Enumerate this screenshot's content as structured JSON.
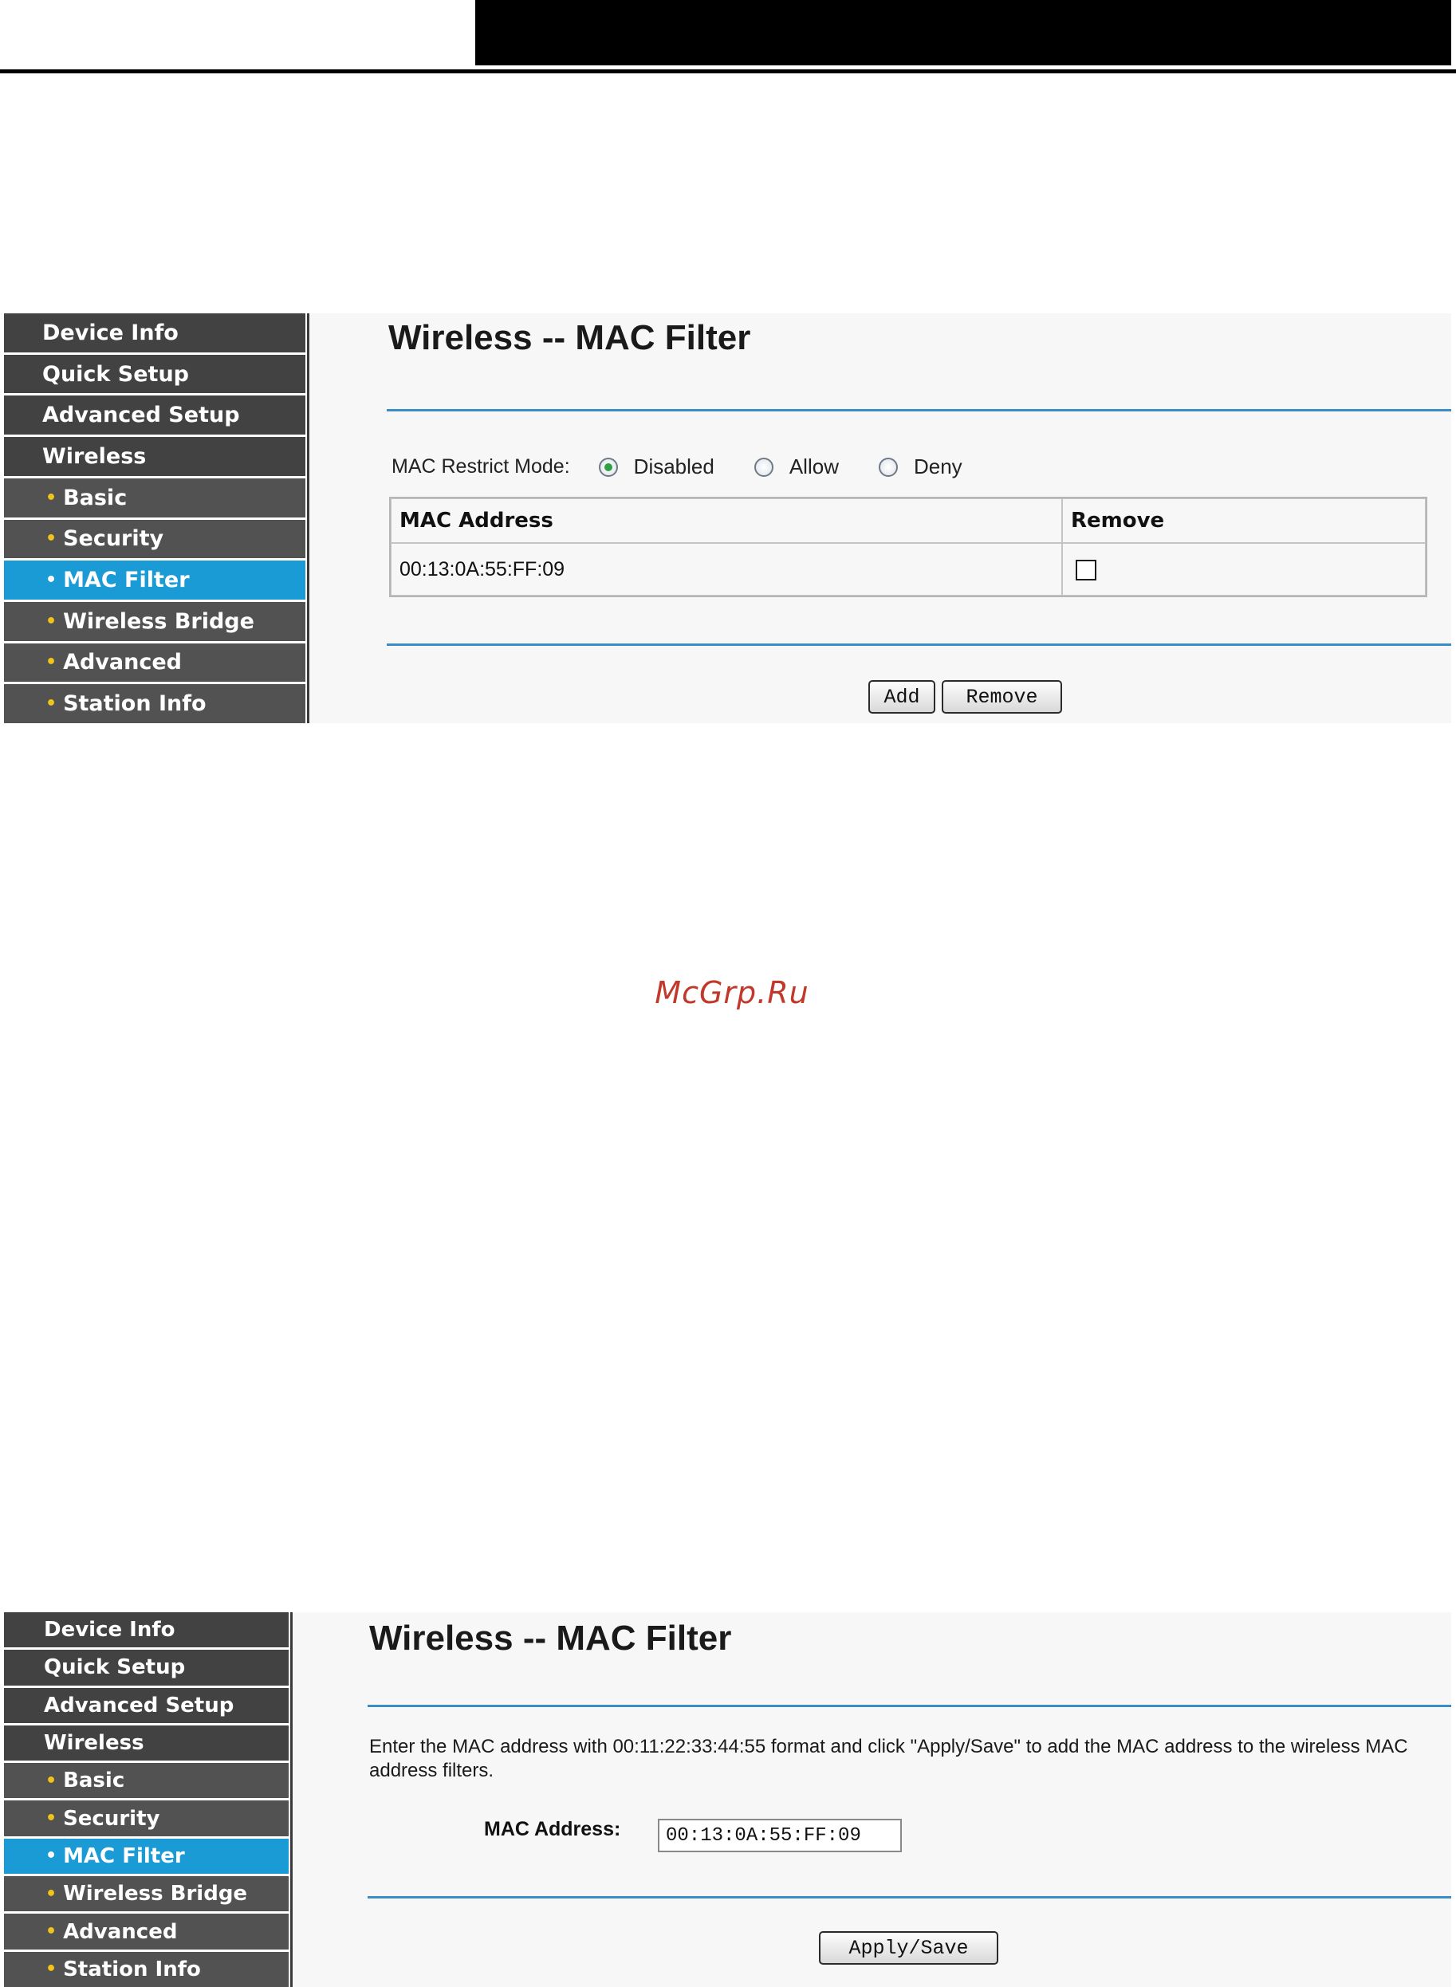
{
  "sidebar": {
    "items": [
      {
        "label": "Device Info"
      },
      {
        "label": "Quick Setup"
      },
      {
        "label": "Advanced Setup"
      },
      {
        "label": "Wireless"
      },
      {
        "label": "Basic",
        "bullet": "•"
      },
      {
        "label": "Security",
        "bullet": "•"
      },
      {
        "label": "MAC Filter",
        "bullet": "•"
      },
      {
        "label": "Wireless Bridge",
        "bullet": "•"
      },
      {
        "label": "Advanced",
        "bullet": "•"
      },
      {
        "label": "Station Info",
        "bullet": "•"
      }
    ],
    "active_item": "MAC Filter"
  },
  "panel1": {
    "title": "Wireless -- MAC Filter",
    "restrict_mode": {
      "label": "MAC Restrict Mode:",
      "options": [
        "Disabled",
        "Allow",
        "Deny"
      ],
      "selected": "Disabled"
    },
    "table": {
      "headers": [
        "MAC Address",
        "Remove"
      ],
      "rows": [
        {
          "mac": "00:13:0A:55:FF:09",
          "remove_checked": false
        }
      ]
    },
    "buttons": {
      "add": "Add",
      "remove": "Remove"
    }
  },
  "panel2": {
    "title": "Wireless -- MAC Filter",
    "instructions": "Enter the MAC address with 00:11:22:33:44:55 format and click \"Apply/Save\" to add the MAC address to the wireless MAC address filters.",
    "mac_label": "MAC Address:",
    "mac_value": "00:13:0A:55:FF:09",
    "apply_label": "Apply/Save"
  },
  "watermark": "McGrp.Ru",
  "colors": {
    "nav_bg": "#424242",
    "nav_sub_bg": "#525252",
    "nav_active": "#1a9bd6",
    "bullet": "#f0c419",
    "rule": "#3a8ec5",
    "content_bg": "#f7f7f7",
    "watermark": "#c0392b"
  }
}
